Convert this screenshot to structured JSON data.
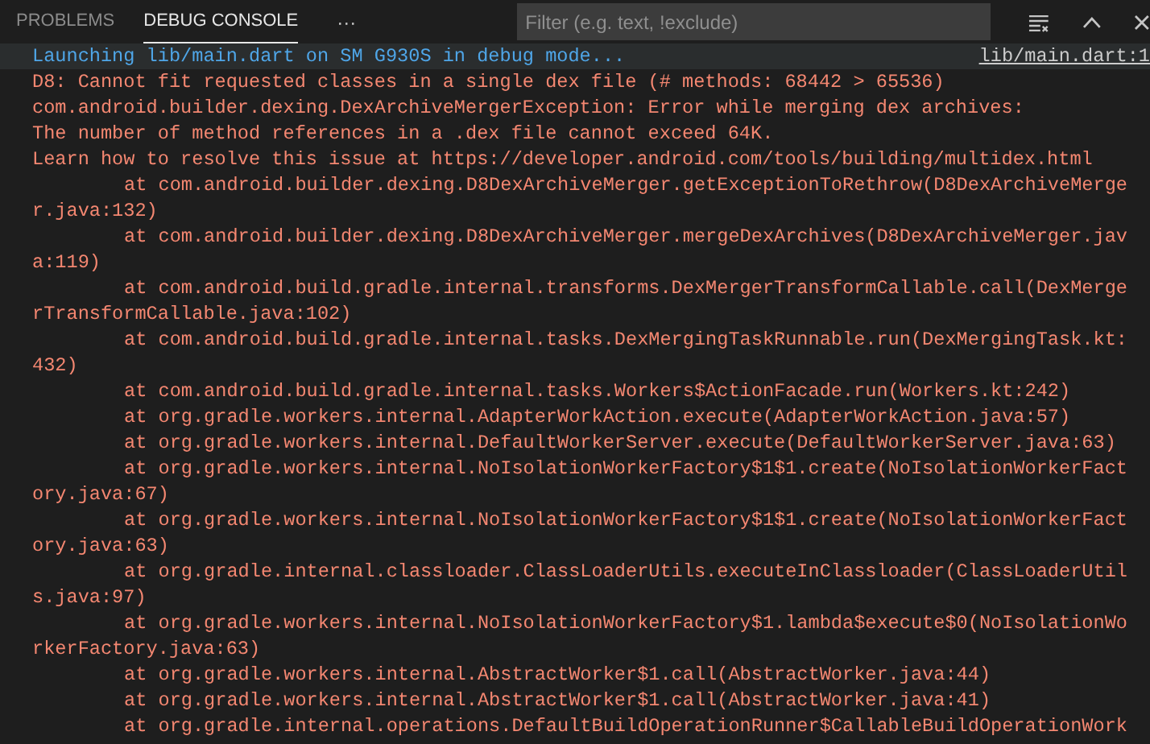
{
  "panel_tabs": [
    {
      "label": "PROBLEMS",
      "selected": false
    },
    {
      "label": "DEBUG CONSOLE",
      "selected": true
    }
  ],
  "more_actions": "···",
  "filter": {
    "placeholder": "Filter (e.g. text, !exclude)"
  },
  "console_lines": [
    {
      "kind": "info",
      "text": "Launching lib/main.dart on SM G930S in debug mode...",
      "source": "lib/main.dart:1"
    },
    {
      "kind": "error",
      "text": "D8: Cannot fit requested classes in a single dex file (# methods: 68442 > 65536)"
    },
    {
      "kind": "error",
      "text": "com.android.builder.dexing.DexArchiveMergerException: Error while merging dex archives:"
    },
    {
      "kind": "error",
      "text": "The number of method references in a .dex file cannot exceed 64K."
    },
    {
      "kind": "error",
      "text": "Learn how to resolve this issue at https://developer.android.com/tools/building/multidex.html"
    },
    {
      "kind": "frame",
      "text": "at com.android.builder.dexing.D8DexArchiveMerger.getExceptionToRethrow(D8DexArchiveMerge"
    },
    {
      "kind": "error",
      "text": "r.java:132)"
    },
    {
      "kind": "frame",
      "text": "at com.android.builder.dexing.D8DexArchiveMerger.mergeDexArchives(D8DexArchiveMerger.jav"
    },
    {
      "kind": "error",
      "text": "a:119)"
    },
    {
      "kind": "frame",
      "text": "at com.android.build.gradle.internal.transforms.DexMergerTransformCallable.call(DexMerge"
    },
    {
      "kind": "error",
      "text": "rTransformCallable.java:102)"
    },
    {
      "kind": "frame",
      "text": "at com.android.build.gradle.internal.tasks.DexMergingTaskRunnable.run(DexMergingTask.kt:"
    },
    {
      "kind": "error",
      "text": "432)"
    },
    {
      "kind": "frame",
      "text": "at com.android.build.gradle.internal.tasks.Workers$ActionFacade.run(Workers.kt:242)"
    },
    {
      "kind": "frame",
      "text": "at org.gradle.workers.internal.AdapterWorkAction.execute(AdapterWorkAction.java:57)"
    },
    {
      "kind": "frame",
      "text": "at org.gradle.workers.internal.DefaultWorkerServer.execute(DefaultWorkerServer.java:63)"
    },
    {
      "kind": "frame",
      "text": "at org.gradle.workers.internal.NoIsolationWorkerFactory$1$1.create(NoIsolationWorkerFact"
    },
    {
      "kind": "error",
      "text": "ory.java:67)"
    },
    {
      "kind": "frame",
      "text": "at org.gradle.workers.internal.NoIsolationWorkerFactory$1$1.create(NoIsolationWorkerFact"
    },
    {
      "kind": "error",
      "text": "ory.java:63)"
    },
    {
      "kind": "frame",
      "text": "at org.gradle.internal.classloader.ClassLoaderUtils.executeInClassloader(ClassLoaderUtil"
    },
    {
      "kind": "error",
      "text": "s.java:97)"
    },
    {
      "kind": "frame",
      "text": "at org.gradle.workers.internal.NoIsolationWorkerFactory$1.lambda$execute$0(NoIsolationWo"
    },
    {
      "kind": "error",
      "text": "rkerFactory.java:63)"
    },
    {
      "kind": "frame",
      "text": "at org.gradle.workers.internal.AbstractWorker$1.call(AbstractWorker.java:44)"
    },
    {
      "kind": "frame",
      "text": "at org.gradle.workers.internal.AbstractWorker$1.call(AbstractWorker.java:41)"
    },
    {
      "kind": "frame",
      "text": "at org.gradle.internal.operations.DefaultBuildOperationRunner$CallableBuildOperationWork"
    }
  ]
}
